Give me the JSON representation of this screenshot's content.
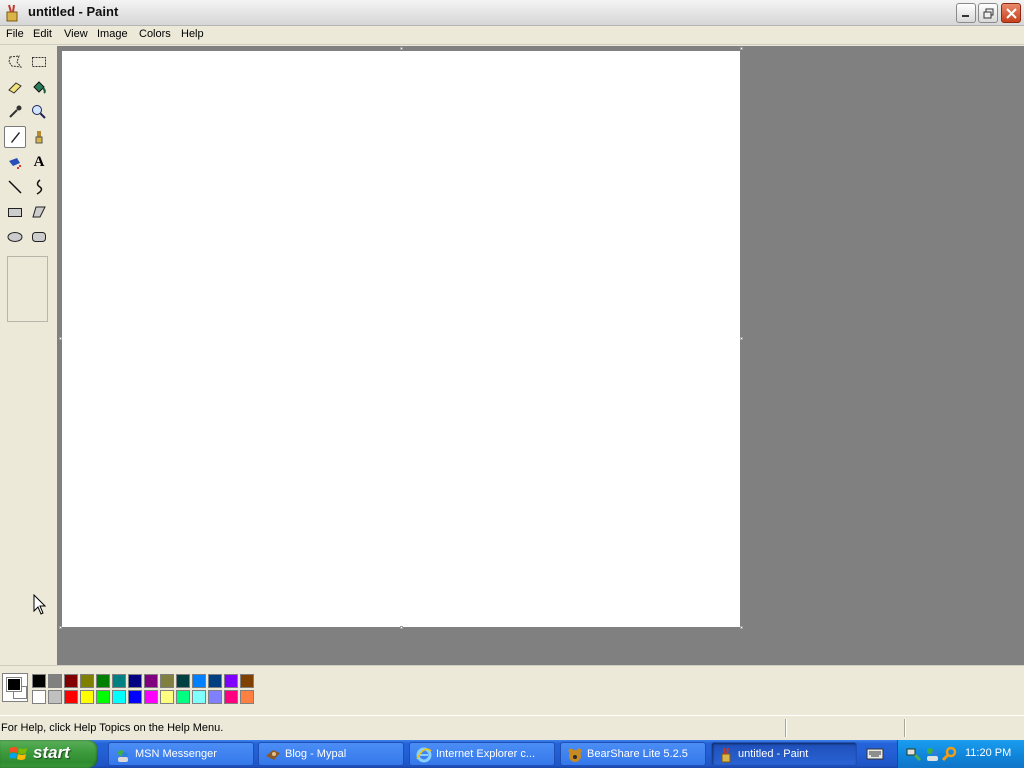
{
  "window": {
    "title": "untitled - Paint"
  },
  "menu": [
    "File",
    "Edit",
    "View",
    "Image",
    "Colors",
    "Help"
  ],
  "tools": [
    {
      "name": "free-form-select-icon"
    },
    {
      "name": "rect-select-icon"
    },
    {
      "name": "eraser-icon"
    },
    {
      "name": "fill-icon"
    },
    {
      "name": "pick-color-icon"
    },
    {
      "name": "magnifier-icon"
    },
    {
      "name": "pencil-icon",
      "selected": true
    },
    {
      "name": "brush-icon"
    },
    {
      "name": "airbrush-icon"
    },
    {
      "name": "text-icon"
    },
    {
      "name": "line-icon"
    },
    {
      "name": "curve-icon"
    },
    {
      "name": "rectangle-icon"
    },
    {
      "name": "polygon-icon"
    },
    {
      "name": "ellipse-icon"
    },
    {
      "name": "rounded-rect-icon"
    }
  ],
  "text_tool_glyph": "A",
  "colors": {
    "foreground": "#000000",
    "background": "#ffffff",
    "palette_row1": [
      "#000000",
      "#808080",
      "#800000",
      "#808000",
      "#008000",
      "#008080",
      "#000080",
      "#800080",
      "#808040",
      "#004040",
      "#0080ff",
      "#004080",
      "#8000ff",
      "#804000"
    ],
    "palette_row2": [
      "#ffffff",
      "#c0c0c0",
      "#ff0000",
      "#ffff00",
      "#00ff00",
      "#00ffff",
      "#0000ff",
      "#ff00ff",
      "#ffff80",
      "#00ff80",
      "#80ffff",
      "#8080ff",
      "#ff0080",
      "#ff8040"
    ]
  },
  "status": {
    "text": "For Help, click Help Topics on the Help Menu."
  },
  "taskbar": {
    "start_label": "start",
    "tasks": [
      {
        "label": "MSN Messenger",
        "icon": "msn-icon"
      },
      {
        "label": "Blog - Mypal",
        "icon": "mypal-icon"
      },
      {
        "label": "Internet Explorer c...",
        "icon": "ie-icon"
      },
      {
        "label": "BearShare Lite 5.2.5",
        "icon": "bearshare-icon"
      },
      {
        "label": "untitled - Paint",
        "icon": "paint-icon",
        "active": true
      }
    ],
    "clock": "11:20 PM"
  }
}
